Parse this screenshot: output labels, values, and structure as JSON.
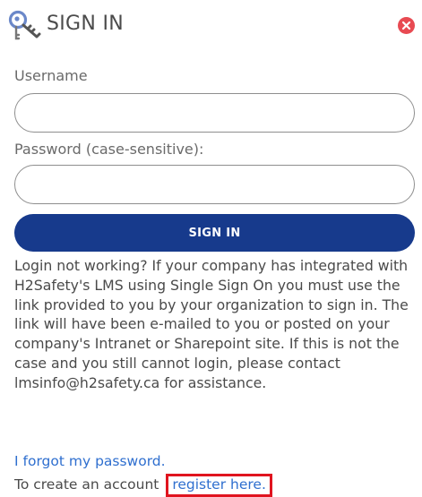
{
  "header": {
    "title": "SIGN IN",
    "icon": "keys-icon",
    "close_icon": "close-icon",
    "close_color": "#e84a52"
  },
  "form": {
    "username_label": "Username",
    "username_value": "",
    "password_label": "Password (case-sensitive):",
    "password_value": "",
    "submit_label": "SIGN IN",
    "submit_color": "#173a8c"
  },
  "help": {
    "text": "Login not working? If your company has integrated with H2Safety's LMS using Single Sign On you must use the link provided to you by your organization to sign in. The link will have been e-mailed to you or posted on your company's Intranet or Sharepoint site. If this is not the case and you still cannot login, please contact lmsinfo@h2safety.ca for assistance."
  },
  "links": {
    "forgot_password": "I forgot my password.",
    "create_account_prefix": "To create an account",
    "register": "register here.",
    "link_color": "#2f6fcf",
    "highlight_color": "#e0141f"
  }
}
